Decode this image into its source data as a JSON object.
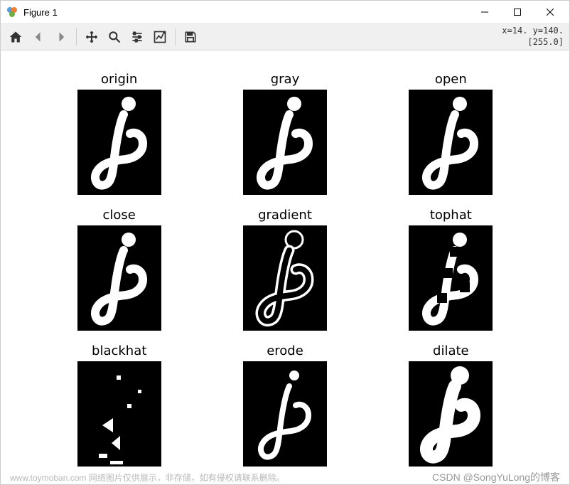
{
  "window": {
    "title": "Figure 1"
  },
  "toolbar": {
    "coords_line1": "x=14.  y=140.",
    "coords_line2": "[255.0]"
  },
  "figure": {
    "subplots": [
      {
        "title": "origin",
        "variant": "normal"
      },
      {
        "title": "gray",
        "variant": "normal"
      },
      {
        "title": "open",
        "variant": "normal"
      },
      {
        "title": "close",
        "variant": "normal"
      },
      {
        "title": "gradient",
        "variant": "outline"
      },
      {
        "title": "tophat",
        "variant": "fragments"
      },
      {
        "title": "blackhat",
        "variant": "specks"
      },
      {
        "title": "erode",
        "variant": "thin"
      },
      {
        "title": "dilate",
        "variant": "thick"
      }
    ]
  },
  "watermark": {
    "left": "www.toymoban.com  网络图片仅供展示，非存储，如有侵权请联系删除。",
    "right": "CSDN @SongYuLong的博客"
  }
}
